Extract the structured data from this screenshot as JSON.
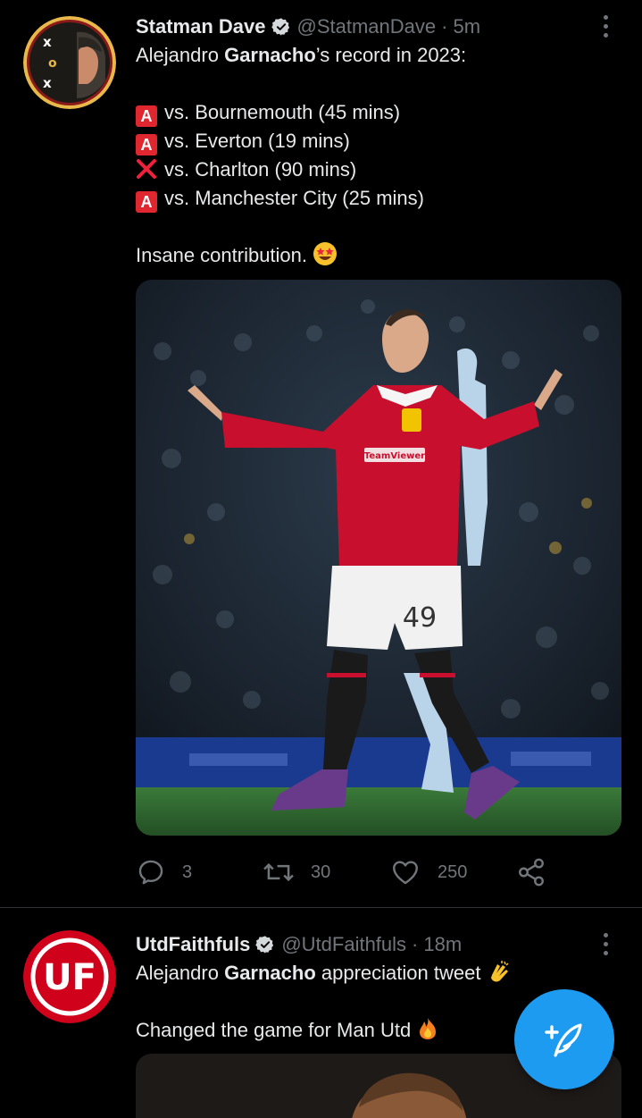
{
  "tweets": [
    {
      "author": {
        "name": "Statman Dave",
        "handle": "@StatmanDave",
        "time": "5m"
      },
      "avatar_icon": "tactics-board-avatar",
      "text": {
        "intro_a": "Alejandro ",
        "intro_b": "Garnacho",
        "intro_c": "’s record in 2023:",
        "results": [
          {
            "mark": "A",
            "icon": "red-a-button-emoji",
            "label": "vs. Bournemouth (45 mins)"
          },
          {
            "mark": "A",
            "icon": "red-a-button-emoji",
            "label": "vs. Everton (19 mins)"
          },
          {
            "mark": "x",
            "icon": "cross-mark-emoji",
            "label": "vs. Charlton (90 mins)"
          },
          {
            "mark": "A",
            "icon": "red-a-button-emoji",
            "label": "vs. Manchester City (25 mins)"
          }
        ],
        "closing": "Insane contribution.",
        "closing_emoji": "star-struck-emoji"
      },
      "media": {
        "player_number": "49",
        "sponsor": "TeamViewer",
        "colors": {
          "shirt": "#c8102e",
          "shorts": "#f1f1f1",
          "pitch": "#2e6b2f",
          "ad_board": "#1a3a8f"
        }
      },
      "stats": {
        "replies": "3",
        "retweets": "30",
        "likes": "250"
      }
    },
    {
      "author": {
        "name": "UtdFaithfuls",
        "handle": "@UtdFaithfuls",
        "time": "18m"
      },
      "avatar": {
        "text": "UF",
        "color": "#d0021b"
      },
      "text": {
        "intro_a": "Alejandro ",
        "intro_b": "Garnacho",
        "intro_c": " appreciation tweet",
        "intro_emoji": "clapping-hands-emoji",
        "line2": "Changed the game for Man Utd",
        "line2_emoji": "fire-emoji"
      }
    }
  ],
  "compose": {
    "icon": "compose-feather-icon",
    "color": "#1d9bf0"
  },
  "colors": {
    "accent": "#1d9bf0",
    "muted": "#71767b",
    "text": "#e7e9ea",
    "background": "#000000"
  }
}
